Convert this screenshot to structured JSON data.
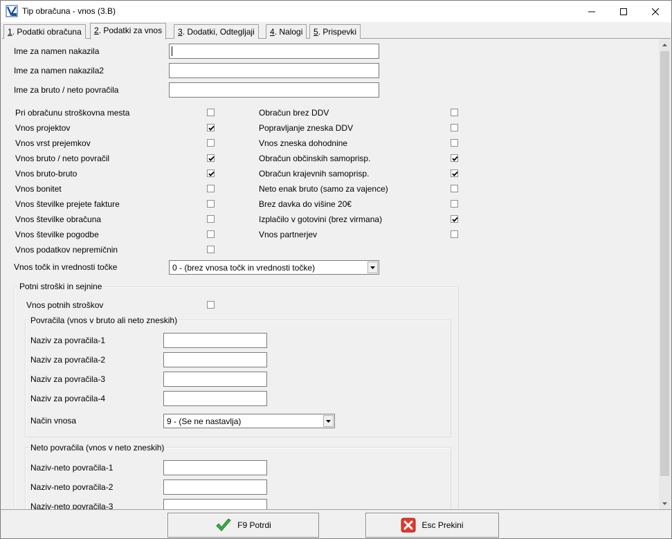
{
  "window": {
    "title": "Tip obračuna - vnos  (3.B)"
  },
  "tabs": [
    {
      "key": "1",
      "label": ". Podatki obračuna"
    },
    {
      "key": "2",
      "label": ". Podatki za vnos"
    },
    {
      "key": "3",
      "label": ". Dodatki, Odtegljaji"
    },
    {
      "key": "4",
      "label": ". Nalogi"
    },
    {
      "key": "5",
      "label": ". Prispevki"
    }
  ],
  "text_fields": [
    {
      "label": "Ime za namen nakazila",
      "value": ""
    },
    {
      "label": "Ime za namen nakazila2",
      "value": ""
    },
    {
      "label": "Ime za bruto / neto povračila",
      "value": ""
    }
  ],
  "checks_left": [
    {
      "label": "Pri obračunu stroškovna mesta",
      "checked": false
    },
    {
      "label": "Vnos projektov",
      "checked": true
    },
    {
      "label": "Vnos vrst prejemkov",
      "checked": false
    },
    {
      "label": "Vnos bruto / neto povračil",
      "checked": true
    },
    {
      "label": "Vnos bruto-bruto",
      "checked": true
    },
    {
      "label": "Vnos bonitet",
      "checked": false
    },
    {
      "label": "Vnos številke prejete fakture",
      "checked": false
    },
    {
      "label": "Vnos številke obračuna",
      "checked": false
    },
    {
      "label": "Vnos številke pogodbe",
      "checked": false
    },
    {
      "label": "Vnos podatkov nepremičnin",
      "checked": false
    }
  ],
  "checks_right": [
    {
      "label": "Obračun brez DDV",
      "checked": false
    },
    {
      "label": "Popravljanje zneska DDV",
      "checked": false
    },
    {
      "label": "Vnos zneska dohodnine",
      "checked": false
    },
    {
      "label": "Obračun občinskih samoprisp.",
      "checked": true
    },
    {
      "label": "Obračun krajevnih samoprisp.",
      "checked": true
    },
    {
      "label": "Neto enak bruto (samo za vajence)",
      "checked": false
    },
    {
      "label": "Brez davka do višine 20€",
      "checked": false
    },
    {
      "label": "Izplačilo v gotovini (brez virmana)",
      "checked": true
    },
    {
      "label": "Vnos partnerjev",
      "checked": false
    }
  ],
  "tocke": {
    "label": "Vnos točk in vrednosti točke",
    "value": "0 - (brez vnosa točk in vrednosti točke)"
  },
  "potni": {
    "title": "Potni stroški in sejnine",
    "check_label": "Vnos potnih stroškov",
    "checked": false
  },
  "povracila": {
    "title": "Povračila (vnos v bruto ali neto zneskih)",
    "fields": [
      {
        "label": "Naziv za povračila-1",
        "value": ""
      },
      {
        "label": "Naziv za povračila-2",
        "value": ""
      },
      {
        "label": "Naziv za povračila-3",
        "value": ""
      },
      {
        "label": "Naziv za povračila-4",
        "value": ""
      }
    ],
    "nacin_label": "Način vnosa",
    "nacin_value": "9 - (Se ne nastavlja)"
  },
  "neto_povracila": {
    "title": "Neto povračila (vnos v neto zneskih)",
    "fields": [
      {
        "label": "Naziv-neto povračila-1",
        "value": ""
      },
      {
        "label": "Naziv-neto povračila-2",
        "value": ""
      },
      {
        "label": "Naziv-neto povračila-3",
        "value": ""
      }
    ]
  },
  "buttons": {
    "confirm": "F9 Potrdi",
    "cancel": "Esc Prekini"
  },
  "colors": {
    "confirm_icon": "#3cb043",
    "cancel_icon": "#e03a2f"
  }
}
